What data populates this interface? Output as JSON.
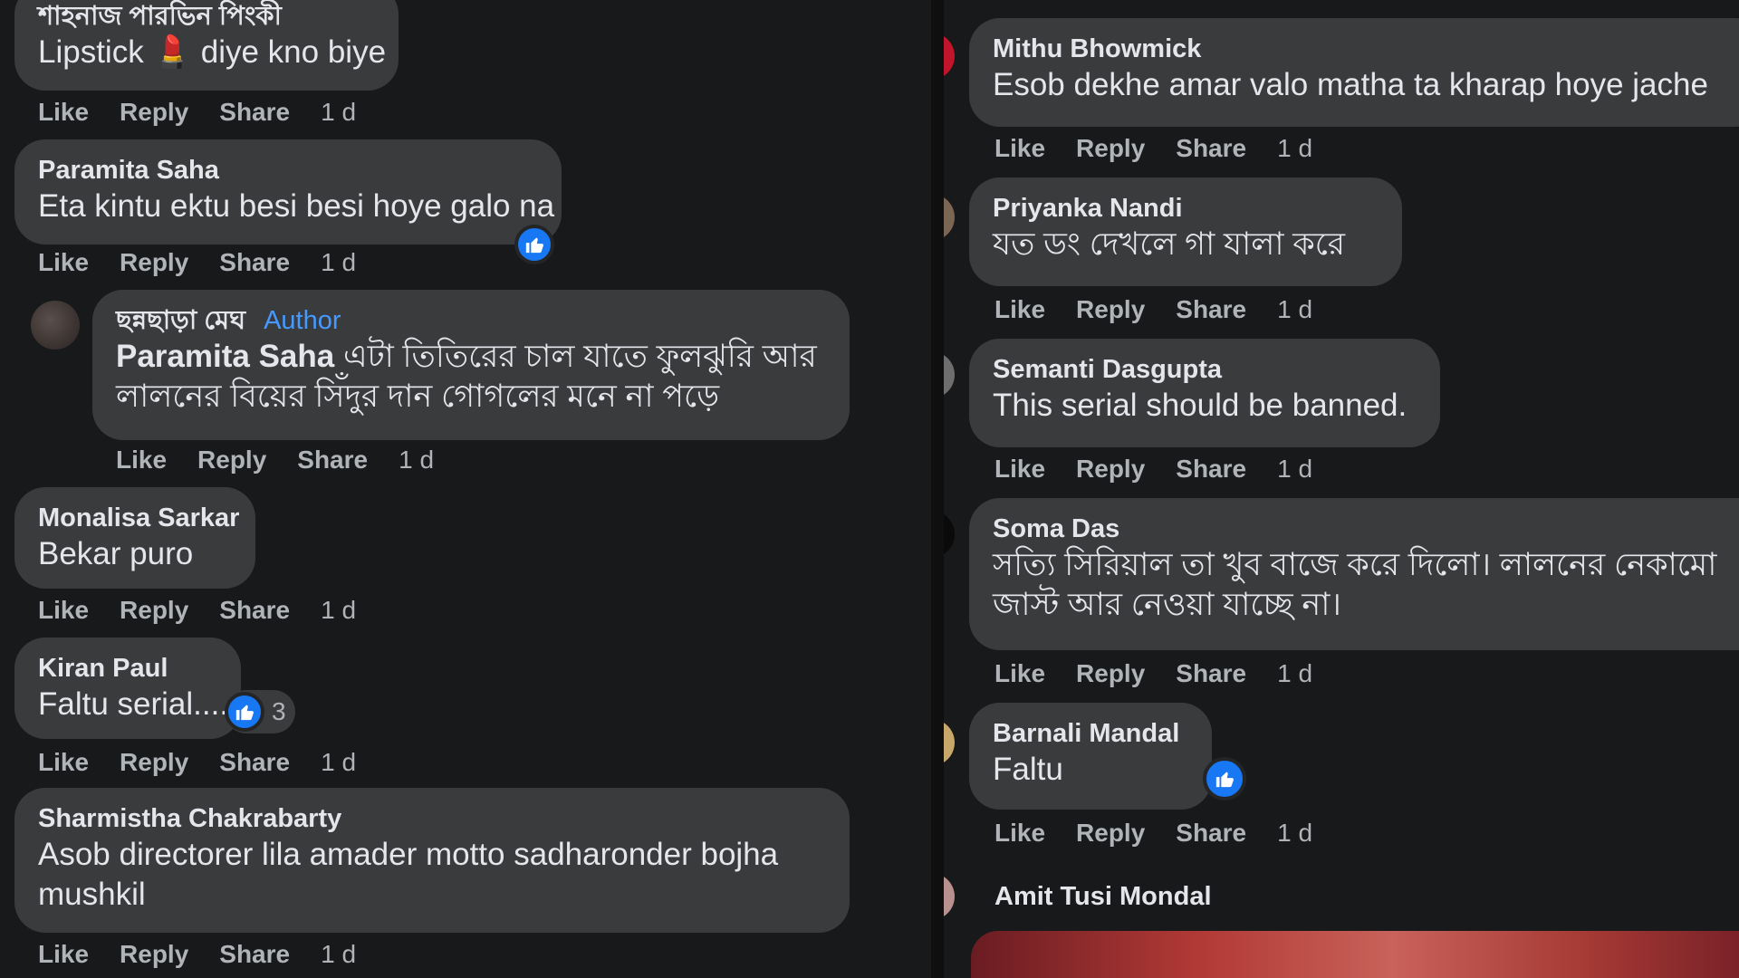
{
  "left": {
    "comments": [
      {
        "name": "শাহনাজ পারভিন পিংকী",
        "text_before": "Lipstick ",
        "emoji": "💄",
        "text_after": " diye kno biye"
      },
      {
        "name": "Paramita Saha",
        "text": "Eta kintu ektu besi besi hoye galo na"
      },
      {
        "name": "ছন্নছাড়া মেঘ",
        "badge": "Author",
        "mention": "Paramita Saha",
        "text_line1": " এটা তিতিরের চাল যাতে ফুলঝুরি আর",
        "text_line2": "লালনের বিয়ের সিঁদুর দান গোগলের মনে না পড়ে"
      },
      {
        "name": "Monalisa Sarkar",
        "text": "Bekar puro"
      },
      {
        "name": "Kiran Paul",
        "text": "Faltu serial.....",
        "reaction_count": "3"
      },
      {
        "name": "Sharmistha Chakrabarty",
        "text_line1": "Asob directorer lila amader motto sadharonder bojha",
        "text_line2": "mushkil"
      }
    ]
  },
  "right": {
    "comments": [
      {
        "name": "Mithu Bhowmick",
        "text": "Esob dekhe amar valo matha ta kharap hoye jache"
      },
      {
        "name": "Priyanka Nandi",
        "text": "যত ডং দেখলে গা যালা করে"
      },
      {
        "name": "Semanti Dasgupta",
        "text": "This serial should be banned."
      },
      {
        "name": "Soma Das",
        "text_line1": "সত্যি সিরিয়াল তা খুব বাজে করে দিলো। লালনের নেকামো",
        "text_line2": "জাস্ট আর নেওয়া যাচ্ছে না।"
      },
      {
        "name": "Barnali Mandal",
        "text": "Faltu"
      },
      {
        "name": "Amit Tusi Mondal"
      }
    ]
  },
  "actions": {
    "like": "Like",
    "reply": "Reply",
    "share": "Share",
    "time": "1 d"
  },
  "icons": {
    "like": "thumbs-up-icon"
  },
  "colors": {
    "background": "#18191a",
    "bubble": "#3a3b3c",
    "text": "#e4e6eb",
    "secondary_text": "#b0b3b8",
    "author_badge": "#4599ff",
    "like_blue": "#1877f2"
  }
}
